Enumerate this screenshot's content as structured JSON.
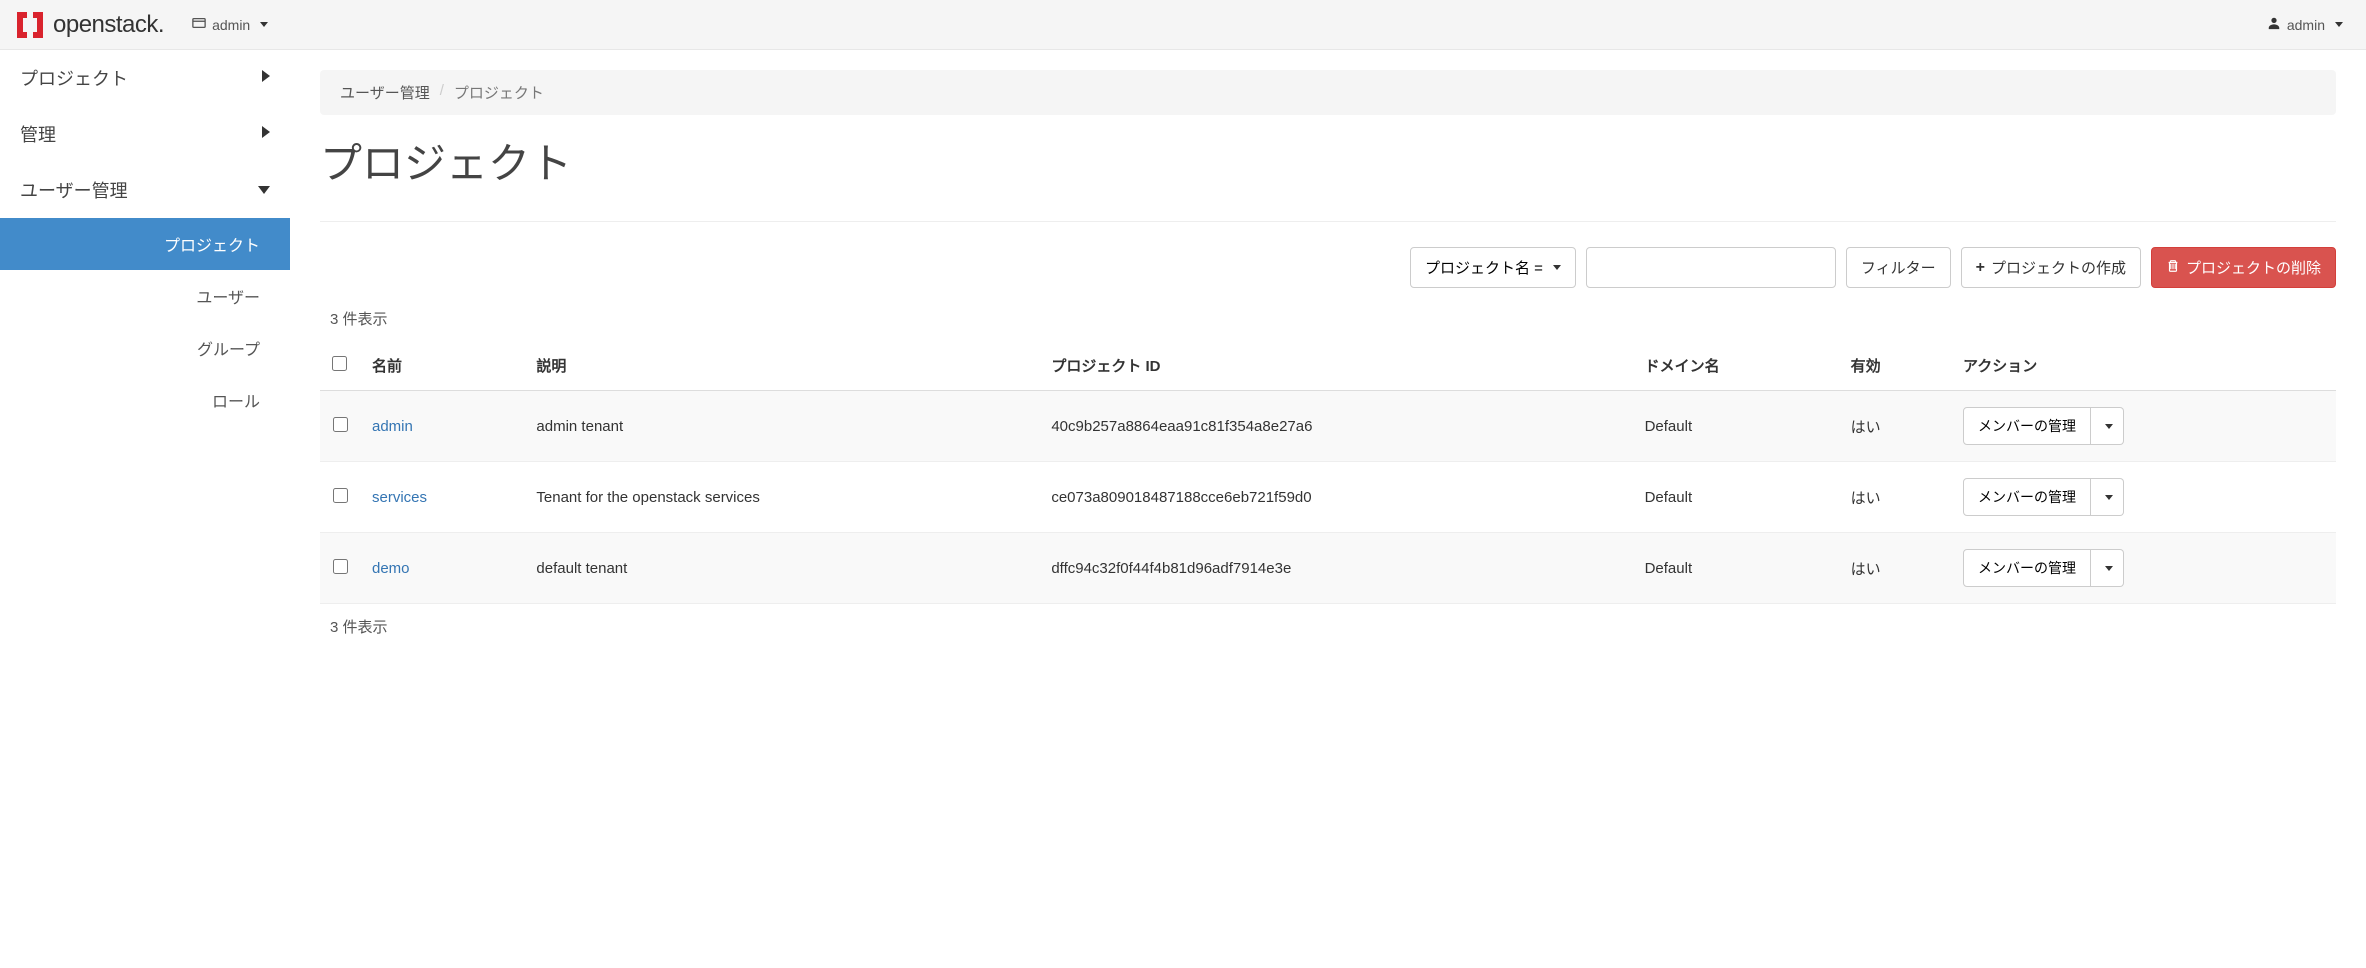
{
  "topbar": {
    "brand_text": "openstack.",
    "domain_label": "admin",
    "user_label": "admin"
  },
  "sidebar": {
    "items": [
      {
        "label": "プロジェクト",
        "expanded": false
      },
      {
        "label": "管理",
        "expanded": false
      },
      {
        "label": "ユーザー管理",
        "expanded": true
      }
    ],
    "user_mgmt_sub": [
      {
        "label": "プロジェクト",
        "active": true
      },
      {
        "label": "ユーザー",
        "active": false
      },
      {
        "label": "グループ",
        "active": false
      },
      {
        "label": "ロール",
        "active": false
      }
    ]
  },
  "breadcrumb": {
    "root": "ユーザー管理",
    "current": "プロジェクト"
  },
  "page_title": "プロジェクト",
  "actions": {
    "filter_select": "プロジェクト名 =",
    "filter_btn": "フィルター",
    "create_btn": "プロジェクトの作成",
    "delete_btn": "プロジェクトの削除"
  },
  "count_label_top": "3 件表示",
  "count_label_bottom": "3 件表示",
  "table": {
    "headers": {
      "name": "名前",
      "desc": "説明",
      "project_id": "プロジェクト ID",
      "domain": "ドメイン名",
      "enabled": "有効",
      "actions": "アクション"
    },
    "row_action": "メンバーの管理",
    "rows": [
      {
        "name": "admin",
        "desc": "admin tenant",
        "project_id": "40c9b257a8864eaa91c81f354a8e27a6",
        "domain": "Default",
        "enabled": "はい"
      },
      {
        "name": "services",
        "desc": "Tenant for the openstack services",
        "project_id": "ce073a809018487188cce6eb721f59d0",
        "domain": "Default",
        "enabled": "はい"
      },
      {
        "name": "demo",
        "desc": "default tenant",
        "project_id": "dffc94c32f0f44f4b81d96adf7914e3e",
        "domain": "Default",
        "enabled": "はい"
      }
    ]
  }
}
